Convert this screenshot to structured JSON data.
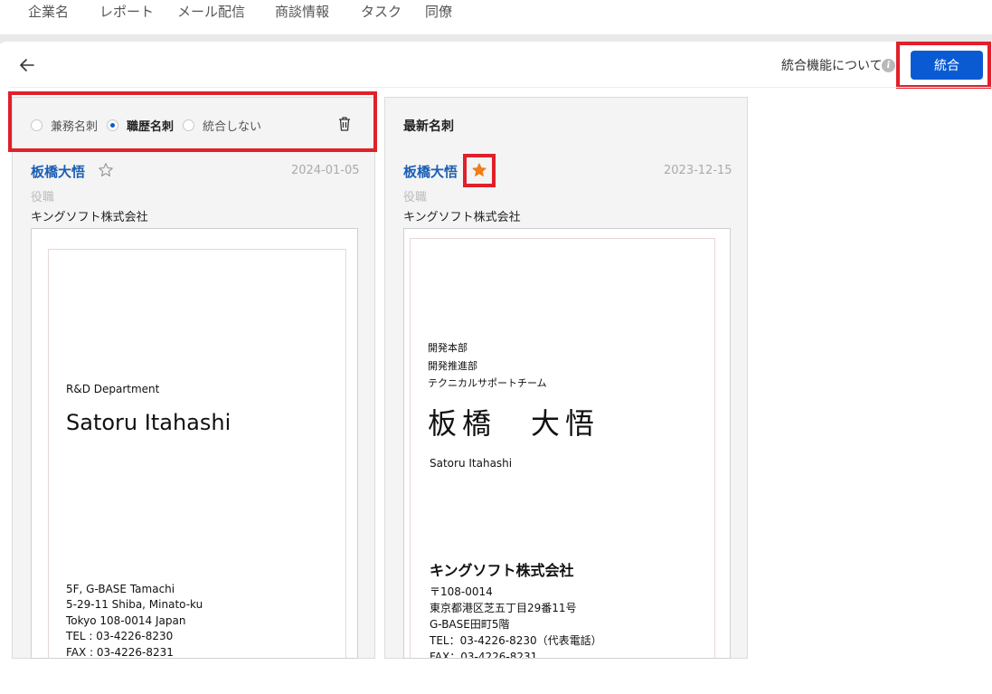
{
  "nav": {
    "items": [
      "企業名",
      "レポート",
      "メール配信",
      "商談情報",
      "タスク",
      "同僚"
    ]
  },
  "header": {
    "about_label": "統合機能について",
    "info_icon_glyph": "i",
    "merge_button": "統合"
  },
  "left_card": {
    "radio_options": [
      {
        "label": "兼務名刺",
        "selected": false
      },
      {
        "label": "職歴名刺",
        "selected": true
      },
      {
        "label": "統合しない",
        "selected": false
      }
    ],
    "name": "板橋大悟",
    "starred": false,
    "date": "2024-01-05",
    "position_placeholder": "役職",
    "company": "キングソフト株式会社",
    "card_image": {
      "department": "R&D Department",
      "name_en": "Satoru Itahashi",
      "address_lines": [
        "5F, G-BASE Tamachi",
        "5-29-11 Shiba, Minato-ku",
        "Tokyo 108-0014 Japan",
        "TEL : 03-4226-8230",
        "FAX : 03-4226-8231"
      ]
    }
  },
  "right_card": {
    "title": "最新名刺",
    "name": "板橋大悟",
    "starred": true,
    "date": "2023-12-15",
    "position_placeholder": "役職",
    "company": "キングソフト株式会社",
    "card_image": {
      "dept_lines": [
        "開発本部",
        "開発推進部",
        "テクニカルサポートチーム"
      ],
      "name_jp": "板橋　大悟",
      "name_en": "Satoru Itahashi",
      "company": "キングソフト株式会社",
      "address_lines": [
        "〒108-0014",
        "東京都港区芝五丁目29番11号",
        "G-BASE田町5階",
        "TEL：03-4226-8230（代表電話）",
        "FAX：03-4226-8231"
      ]
    }
  },
  "colors": {
    "accent": "#0a5bd3",
    "highlight": "#e0202a",
    "star_active": "#f07d1a",
    "name_link": "#1a5fb4"
  }
}
